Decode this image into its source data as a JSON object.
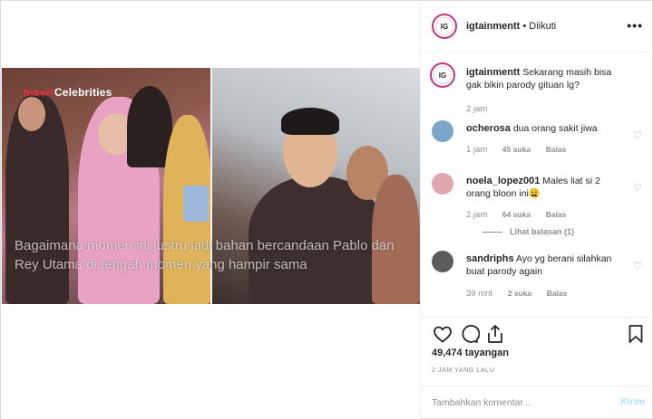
{
  "post": {
    "author": "igtainmentt",
    "follow_status": "• Diikuti",
    "more_label": "•••",
    "avatar_text": "IG"
  },
  "video": {
    "logo_red": "Insert",
    "logo_white": "Celebrities",
    "caption": "Bagaimana momen ini justru jadi bahan bercandaan Pablo dan Rey Utama di tengah momen yang hampir sama"
  },
  "caption_comment": {
    "username": "igtainmentt",
    "text": "Sekarang masih bisa gak bikin parody gituan lg?",
    "time": "2 jam"
  },
  "comments": [
    {
      "username": "ocherosa",
      "text": "dua orang sakit jiwa",
      "time": "1 jam",
      "likes": "45 suka",
      "reply": "Balas",
      "avatar_color": "#7aa6c9"
    },
    {
      "username": "noela_lopez001",
      "text": "Males liat si 2 orang bloon ini😩",
      "time": "2 jam",
      "likes": "64 suka",
      "reply": "Balas",
      "view_replies": "Lihat balasan (1)",
      "avatar_color": "#e0a7b2"
    },
    {
      "username": "sandriphs",
      "text": "Ayo yg berani silahkan buat parody again",
      "time": "39 mnt",
      "likes": "2 suka",
      "reply": "Balas",
      "avatar_color": "#5c5c5c"
    }
  ],
  "stats": {
    "views": "49,474 tayangan",
    "posted_ago": "2 JAM YANG LALU"
  },
  "composer": {
    "placeholder": "Tambahkan komentar...",
    "send_label": "Kirim"
  }
}
